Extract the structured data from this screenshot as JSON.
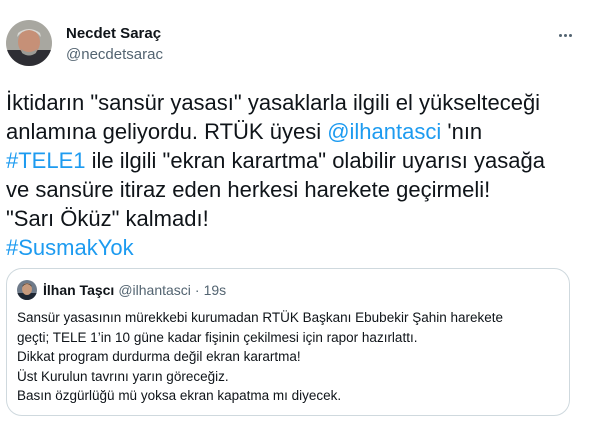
{
  "author": {
    "display_name": "Necdet Saraç",
    "handle": "@necdetsarac"
  },
  "tweet": {
    "lines": [
      [
        {
          "t": "text",
          "v": "İktidarın \"sansür yasası\" yasaklarla ilgili el yükselteceği"
        }
      ],
      [
        {
          "t": "text",
          "v": "anlamına geliyordu. RTÜK üyesi "
        },
        {
          "t": "mention",
          "v": "@ilhantasci"
        },
        {
          "t": "text",
          "v": " 'nın"
        }
      ],
      [
        {
          "t": "hashtag",
          "v": "#TELE1"
        },
        {
          "t": "text",
          "v": " ile ilgili \"ekran karartma\" olabilir uyarısı yasağa"
        }
      ],
      [
        {
          "t": "text",
          "v": "ve sansüre itiraz eden herkesi harekete geçirmeli!"
        }
      ],
      [
        {
          "t": "text",
          "v": "\"Sarı Öküz\" kalmadı!"
        }
      ],
      [
        {
          "t": "hashtag",
          "v": "#SusmakYok"
        }
      ]
    ]
  },
  "quoted_tweet": {
    "display_name": "İlhan Taşcı",
    "handle": "@ilhantasci",
    "separator": "·",
    "time": "19s",
    "lines": [
      "Sansür yasasının mürekkebi kurumadan RTÜK Başkanı Ebubekir Şahin harekete",
      "geçti; TELE 1’in 10 güne kadar fişinin çekilmesi için rapor hazırlattı.",
      "Dikkat program durdurma değil ekran karartma!",
      "Üst Kurulun tavrını yarın göreceğiz.",
      "Basın özgürlüğü mü yoksa ekran kapatma mı diyecek."
    ]
  },
  "icons": {
    "more": "more-horizontal-icon"
  },
  "colors": {
    "link": "#1d9bf0",
    "secondary_text": "#536471",
    "border": "#cfd9de"
  }
}
